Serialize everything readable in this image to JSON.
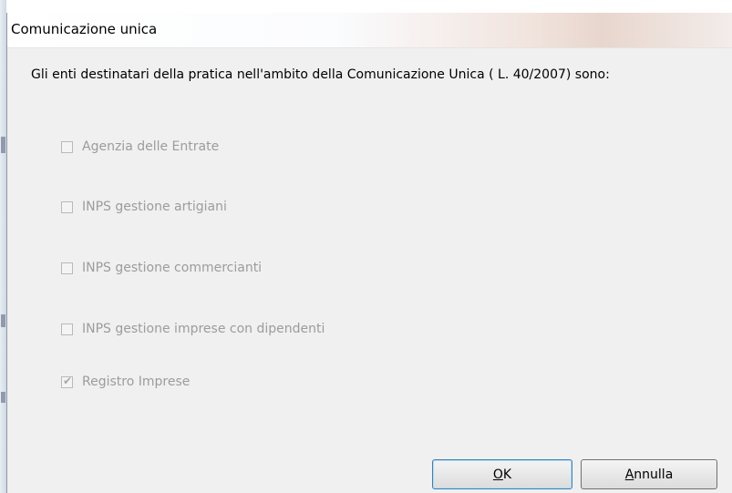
{
  "dialog": {
    "title": "Comunicazione unica",
    "description": "Gli enti destinatari della pratica nell'ambito della Comunicazione Unica ( L. 40/2007) sono:"
  },
  "options": [
    {
      "label": "Agenzia delle Entrate",
      "checked": false,
      "enabled": false
    },
    {
      "label": "INPS gestione artigiani",
      "checked": false,
      "enabled": false
    },
    {
      "label": "INPS gestione commercianti",
      "checked": false,
      "enabled": false
    },
    {
      "label": "INPS gestione imprese con dipendenti",
      "checked": false,
      "enabled": false
    },
    {
      "label": "Registro Imprese",
      "checked": true,
      "enabled": false
    }
  ],
  "buttons": {
    "ok": {
      "accel": "O",
      "rest": "K"
    },
    "cancel": {
      "accel": "A",
      "rest": "nnulla"
    }
  },
  "colors": {
    "dialog_bg": "#f0f0f0",
    "disabled_text": "#9c9c9c",
    "default_button_border": "#3c7fb1"
  }
}
